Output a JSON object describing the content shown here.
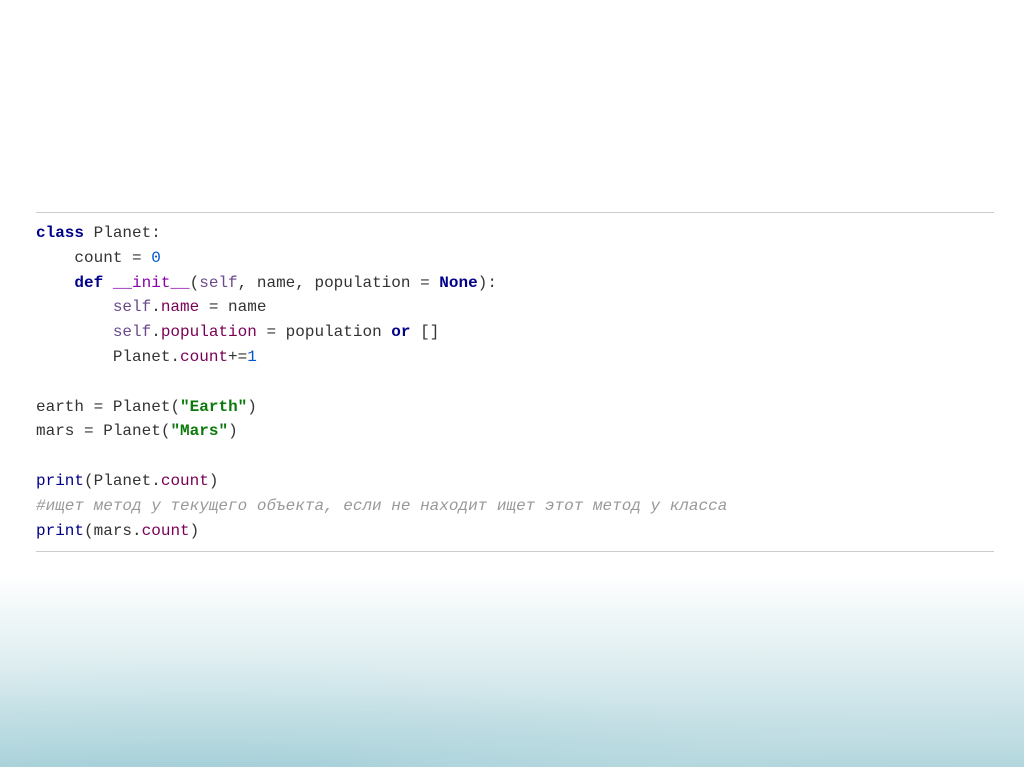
{
  "code": {
    "l1": {
      "kw": "class",
      "name": " Planet",
      "p": ":"
    },
    "l2": {
      "indent": "    ",
      "var": "count",
      "eq": " = ",
      "val": "0"
    },
    "l3": {
      "indent": "    ",
      "kw": "def",
      "sp": " ",
      "fn": "__init__",
      "lp": "(",
      "self": "self",
      "c1": ", ",
      "a1": "name",
      "c2": ", ",
      "a2": "population",
      "eq": " = ",
      "none": "None",
      "rp": ")",
      "colon": ":"
    },
    "l4": {
      "indent": "        ",
      "self": "self",
      "dot": ".",
      "attr": "name",
      "eq": " = ",
      "rhs": "name"
    },
    "l5": {
      "indent": "        ",
      "self": "self",
      "dot": ".",
      "attr": "population",
      "eq": " = ",
      "rhs": "population",
      "sp": " ",
      "or": "or",
      "sp2": " ",
      "lst": "[]"
    },
    "l6": {
      "indent": "        ",
      "cls": "Planet",
      "dot": ".",
      "attr": "count",
      "op": "+=",
      "val": "1"
    },
    "l7": "",
    "l8": {
      "var": "earth",
      "eq": " = ",
      "cls": "Planet",
      "lp": "(",
      "q1": "\"",
      "s": "Earth",
      "q2": "\"",
      "rp": ")"
    },
    "l9": {
      "var": "mars",
      "eq": " = ",
      "cls": "Planet",
      "lp": "(",
      "q1": "\"",
      "s": "Mars",
      "q2": "\"",
      "rp": ")"
    },
    "l10": "",
    "l11": {
      "fn": "print",
      "lp": "(",
      "cls": "Planet",
      "dot": ".",
      "attr": "count",
      "rp": ")"
    },
    "l12": {
      "c": "#ищет метод у текущего объекта, если не находит ищет этот метод у класса"
    },
    "l13": {
      "fn": "print",
      "lp": "(",
      "obj": "mars",
      "dot": ".",
      "attr": "count",
      "rp": ")"
    }
  }
}
